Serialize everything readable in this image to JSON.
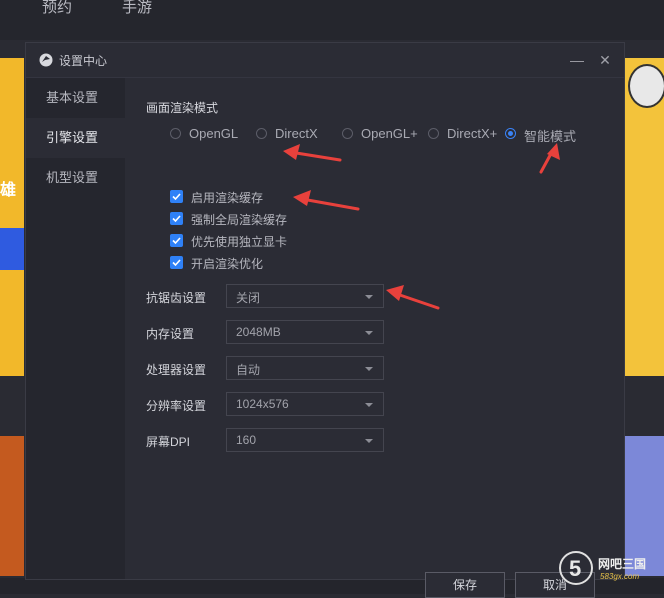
{
  "background": {
    "tabs": [
      "预约",
      "手游"
    ],
    "banner_text": "雄"
  },
  "dialog": {
    "title": "设置中心",
    "minimize_glyph": "—",
    "close_glyph": "✕",
    "sidebar": [
      {
        "label": "基本设置",
        "active": false
      },
      {
        "label": "引擎设置",
        "active": true
      },
      {
        "label": "机型设置",
        "active": false
      }
    ],
    "render_mode": {
      "title": "画面渲染模式",
      "options": [
        {
          "label": "OpenGL",
          "checked": false
        },
        {
          "label": "DirectX",
          "checked": false
        },
        {
          "label": "OpenGL+",
          "checked": false
        },
        {
          "label": "DirectX+",
          "checked": false
        },
        {
          "label": "智能模式",
          "checked": true
        }
      ]
    },
    "checkboxes": [
      {
        "label": "启用渲染缓存",
        "checked": true
      },
      {
        "label": "强制全局渲染缓存",
        "checked": true
      },
      {
        "label": "优先使用独立显卡",
        "checked": true
      },
      {
        "label": "开启渲染优化",
        "checked": true
      }
    ],
    "settings": [
      {
        "label": "抗锯齿设置",
        "value": "关闭"
      },
      {
        "label": "内存设置",
        "value": "2048MB"
      },
      {
        "label": "处理器设置",
        "value": "自动"
      },
      {
        "label": "分辨率设置",
        "value": "1024x576"
      },
      {
        "label": "屏幕DPI",
        "value": "160"
      }
    ],
    "buttons": {
      "save": "保存",
      "cancel": "取消"
    }
  },
  "watermark": {
    "text": "网吧三国",
    "sub": "583gx.com"
  },
  "colors": {
    "accent": "#2f81f7",
    "annotation": "#e8413c"
  }
}
